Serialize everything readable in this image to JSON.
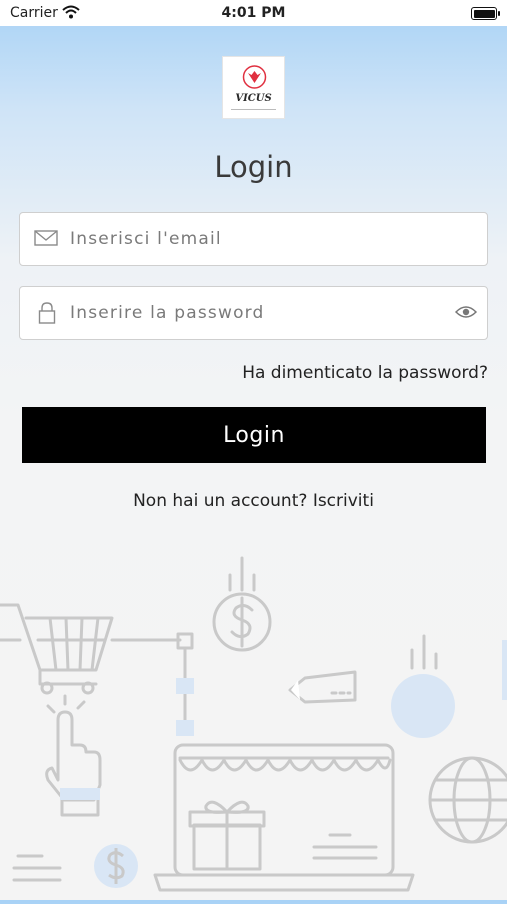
{
  "status_bar": {
    "carrier": "Carrier",
    "time": "4:01 PM"
  },
  "logo": {
    "brand": "VICUS"
  },
  "title": "Login",
  "email_field": {
    "placeholder": "Inserisci l'email",
    "icon": "mail-icon"
  },
  "password_field": {
    "placeholder": "Inserire la password",
    "icon": "lock-icon",
    "toggle_icon": "eye-icon"
  },
  "forgot_password": "Ha dimenticato la password?",
  "login_button": "Login",
  "signup": {
    "prompt": "Non hai un account? ",
    "link": "Iscriviti"
  },
  "colors": {
    "button": "#000000",
    "illustration_line": "#c9c9c9",
    "illustration_accent": "#d9e6f5"
  }
}
